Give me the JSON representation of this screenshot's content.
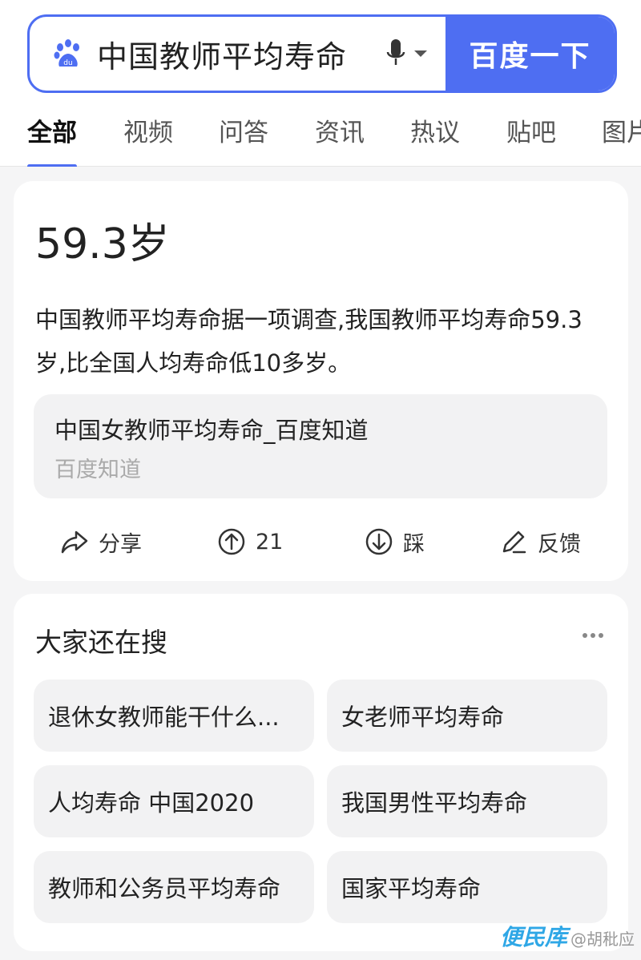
{
  "search": {
    "query": "中国教师平均寿命",
    "button_label": "百度一下"
  },
  "tabs": [
    {
      "label": "全部",
      "active": true
    },
    {
      "label": "视频"
    },
    {
      "label": "问答"
    },
    {
      "label": "资讯"
    },
    {
      "label": "热议"
    },
    {
      "label": "贴吧"
    },
    {
      "label": "图片"
    }
  ],
  "answer": {
    "value": "59.3岁",
    "text": "中国教师平均寿命据一项调查,我国教师平均寿命59.3岁,比全国人均寿命低10多岁。",
    "source_title": "中国女教师平均寿命_百度知道",
    "source_name": "百度知道",
    "actions": {
      "share": "分享",
      "upvote_count": "21",
      "downvote": "踩",
      "feedback": "反馈"
    }
  },
  "related": {
    "title": "大家还在搜",
    "items": [
      "退休女教师能干什么...",
      "女老师平均寿命",
      "人均寿命 中国2020",
      "我国男性平均寿命",
      "教师和公务员平均寿命",
      "国家平均寿命"
    ]
  },
  "watermark": {
    "brand": "便民库",
    "user": "@胡秕应"
  },
  "colors": {
    "accent": "#4e6ef2",
    "chip_bg": "#f2f2f3",
    "page_bg": "#f5f5f6"
  }
}
